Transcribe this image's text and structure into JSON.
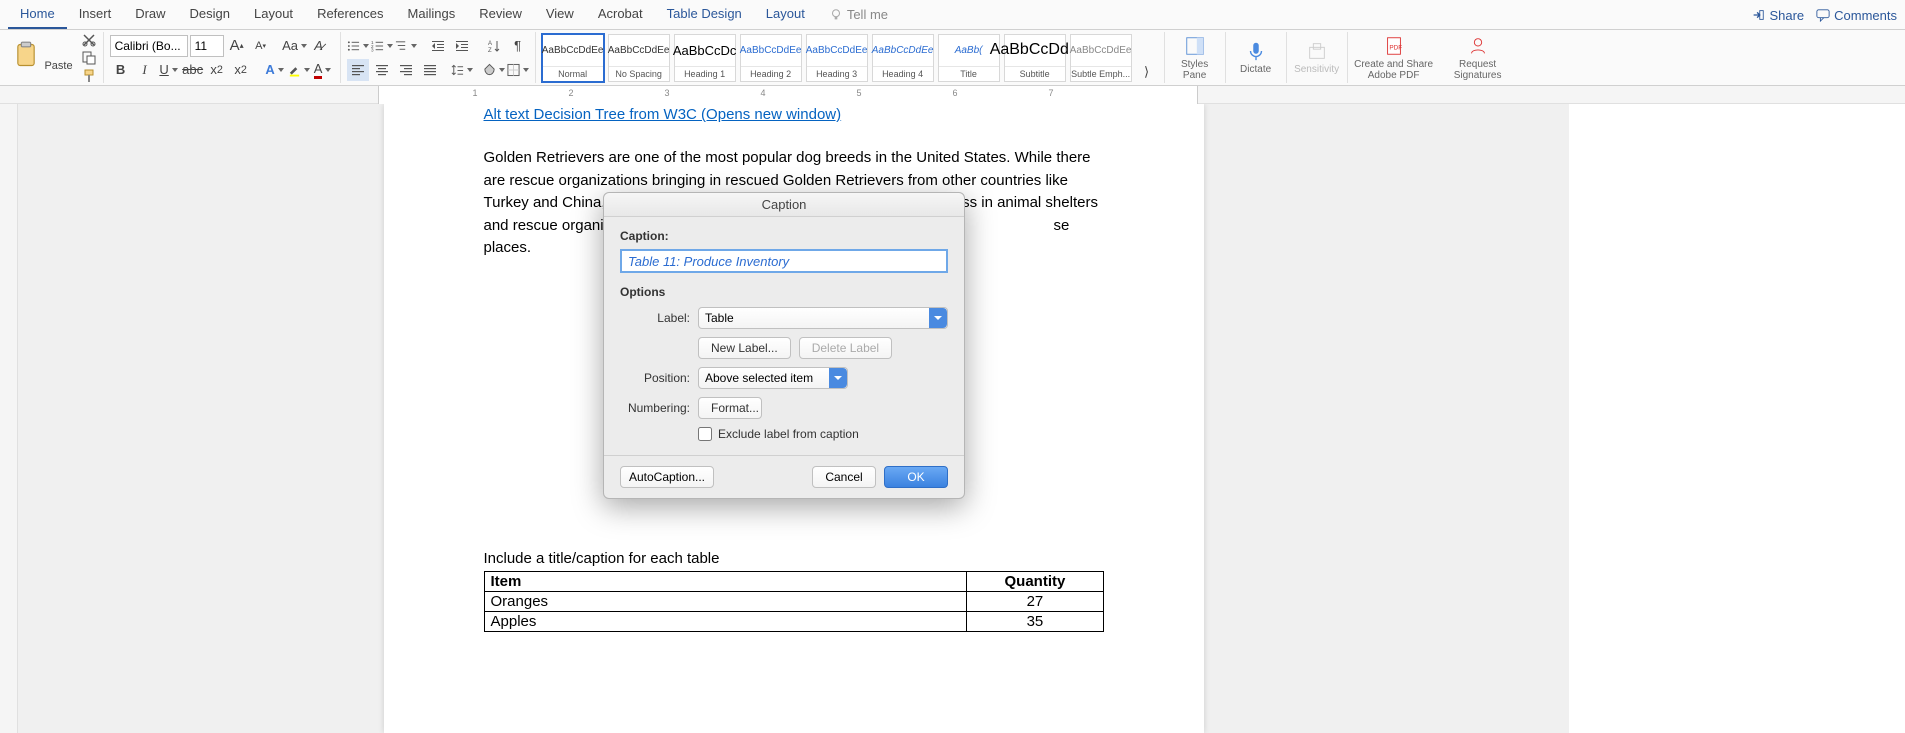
{
  "menu": {
    "tabs": [
      "Home",
      "Insert",
      "Draw",
      "Design",
      "Layout",
      "References",
      "Mailings",
      "Review",
      "View",
      "Acrobat",
      "Table Design",
      "Layout"
    ],
    "active_index": 0,
    "context_start_index": 10,
    "tell_me": "Tell me",
    "share": "Share",
    "comments": "Comments"
  },
  "ribbon": {
    "paste": "Paste",
    "font_name": "Calibri (Bo...",
    "font_size": "11",
    "styles_pane": "Styles Pane",
    "dictate": "Dictate",
    "sensitivity": "Sensitivity",
    "create_share": "Create and Share Adobe PDF",
    "request_sig": "Request Signatures",
    "styles": [
      {
        "sample": "AaBbCcDdEe",
        "name": "Normal"
      },
      {
        "sample": "AaBbCcDdEe",
        "name": "No Spacing"
      },
      {
        "sample": "AaBbCcDc",
        "name": "Heading 1"
      },
      {
        "sample": "AaBbCcDdEe",
        "name": "Heading 2"
      },
      {
        "sample": "AaBbCcDdEe",
        "name": "Heading 3"
      },
      {
        "sample": "AaBbCcDdEe",
        "name": "Heading 4"
      },
      {
        "sample": "AaBb(",
        "name": "Title"
      },
      {
        "sample": "AaBbCcDdE",
        "name": "Subtitle"
      },
      {
        "sample": "AaBbCcDdEe",
        "name": "Subtle Emph..."
      }
    ]
  },
  "document": {
    "link_text": "Alt text Decision Tree from W3C (Opens new window)",
    "body": "Golden Retrievers are one of the most popular dog breeds in the United States. While there are rescue organizations bringing in rescued Golden Retrievers from other countries like Turkey and China, purebred Golden Retrievers are difficult to come across in animal shelters and rescue organizations.  Gold",
    "body_tail": "se places.",
    "caption_heading": "Include a title/caption for each table",
    "table": {
      "headers": [
        "Item",
        "Quantity"
      ],
      "rows": [
        {
          "item": "Oranges",
          "qty": "27"
        },
        {
          "item": "Apples",
          "qty": "35"
        }
      ]
    }
  },
  "dialog": {
    "title": "Caption",
    "caption_label": "Caption:",
    "caption_value": "Table 11: Produce Inventory",
    "options_label": "Options",
    "label_label": "Label:",
    "label_value": "Table",
    "new_label": "New Label...",
    "delete_label": "Delete Label",
    "position_label": "Position:",
    "position_value": "Above selected item",
    "numbering_label": "Numbering:",
    "format_btn": "Format...",
    "exclude": "Exclude label from caption",
    "autocaption": "AutoCaption...",
    "cancel": "Cancel",
    "ok": "OK"
  },
  "ruler": {
    "marks": [
      1,
      2,
      3,
      4,
      5,
      6,
      7
    ]
  }
}
